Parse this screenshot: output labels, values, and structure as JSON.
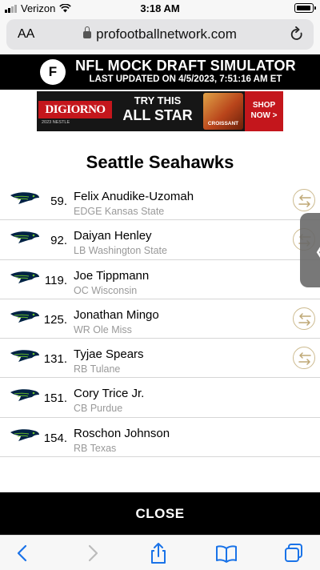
{
  "status_bar": {
    "carrier": "Verizon",
    "time": "3:18 AM"
  },
  "browser": {
    "text_size_label": "AA",
    "url": "profootballnetwork.com"
  },
  "simulator": {
    "logo_text": "F",
    "title": "NFL MOCK DRAFT SIMULATOR",
    "updated": "LAST UPDATED ON 4/5/2023, 7:51:16 AM ET"
  },
  "ad": {
    "brand": "DIGIORNO",
    "brand_sub": "2023 NESTLE",
    "headline_1": "TRY THIS",
    "headline_2": "ALL STAR",
    "product": "CROISSANT",
    "cta_1": "SHOP",
    "cta_2": "NOW >"
  },
  "team": {
    "name": "Seattle Seahawks",
    "accent_color": "#002244",
    "accent_secondary": "#69BE28"
  },
  "picks": [
    {
      "number": "59.",
      "name": "Felix Anudike-Uzomah",
      "details": "EDGE Kansas State",
      "tradeable": true
    },
    {
      "number": "92.",
      "name": "Daiyan Henley",
      "details": "LB Washington State",
      "tradeable": true
    },
    {
      "number": "119.",
      "name": "Joe Tippmann",
      "details": "OC Wisconsin",
      "tradeable": false
    },
    {
      "number": "125.",
      "name": "Jonathan Mingo",
      "details": "WR Ole Miss",
      "tradeable": true
    },
    {
      "number": "131.",
      "name": "Tyjae Spears",
      "details": "RB Tulane",
      "tradeable": true
    },
    {
      "number": "151.",
      "name": "Cory Trice Jr.",
      "details": "CB Purdue",
      "tradeable": false
    },
    {
      "number": "154.",
      "name": "Roschon Johnson",
      "details": "RB Texas",
      "tradeable": false
    }
  ],
  "drawer": {
    "toggle_glyph": "〈"
  },
  "close_label": "CLOSE",
  "toolbar": {
    "icons": [
      "back-icon",
      "forward-icon",
      "share-icon",
      "bookmarks-icon",
      "tabs-icon"
    ]
  }
}
